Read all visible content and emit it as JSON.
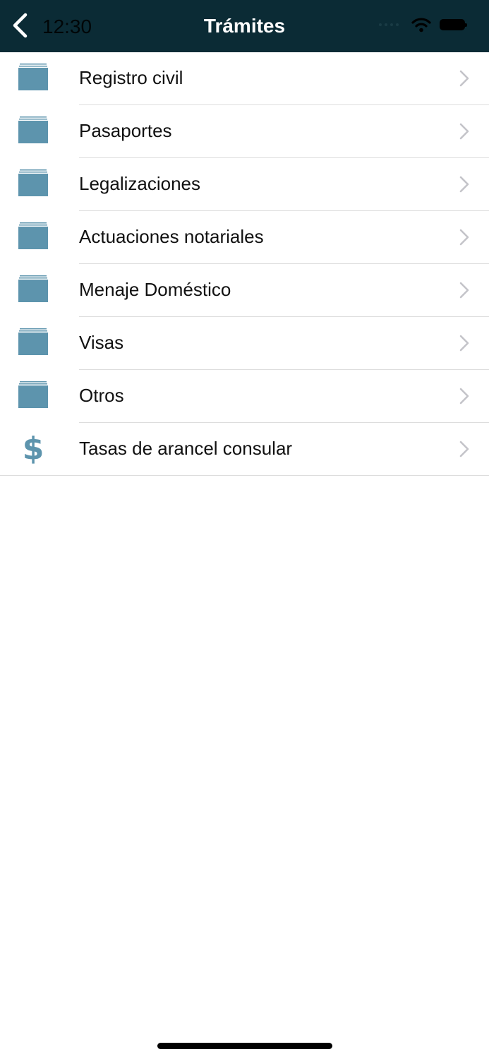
{
  "status_bar": {
    "time": "12:30"
  },
  "header": {
    "title": "Trámites"
  },
  "colors": {
    "header_bg": "#0b2b35",
    "icon": "#5d94ad",
    "chevron": "#c4c4c9",
    "separator": "#dddddd"
  },
  "list": {
    "items": [
      {
        "label": "Registro civil",
        "icon": "folder-icon"
      },
      {
        "label": "Pasaportes",
        "icon": "folder-icon"
      },
      {
        "label": "Legalizaciones",
        "icon": "folder-icon"
      },
      {
        "label": "Actuaciones notariales",
        "icon": "folder-icon"
      },
      {
        "label": "Menaje Doméstico",
        "icon": "folder-icon"
      },
      {
        "label": "Visas",
        "icon": "folder-icon"
      },
      {
        "label": "Otros",
        "icon": "folder-icon"
      },
      {
        "label": "Tasas de arancel consular",
        "icon": "dollar-icon"
      }
    ]
  }
}
